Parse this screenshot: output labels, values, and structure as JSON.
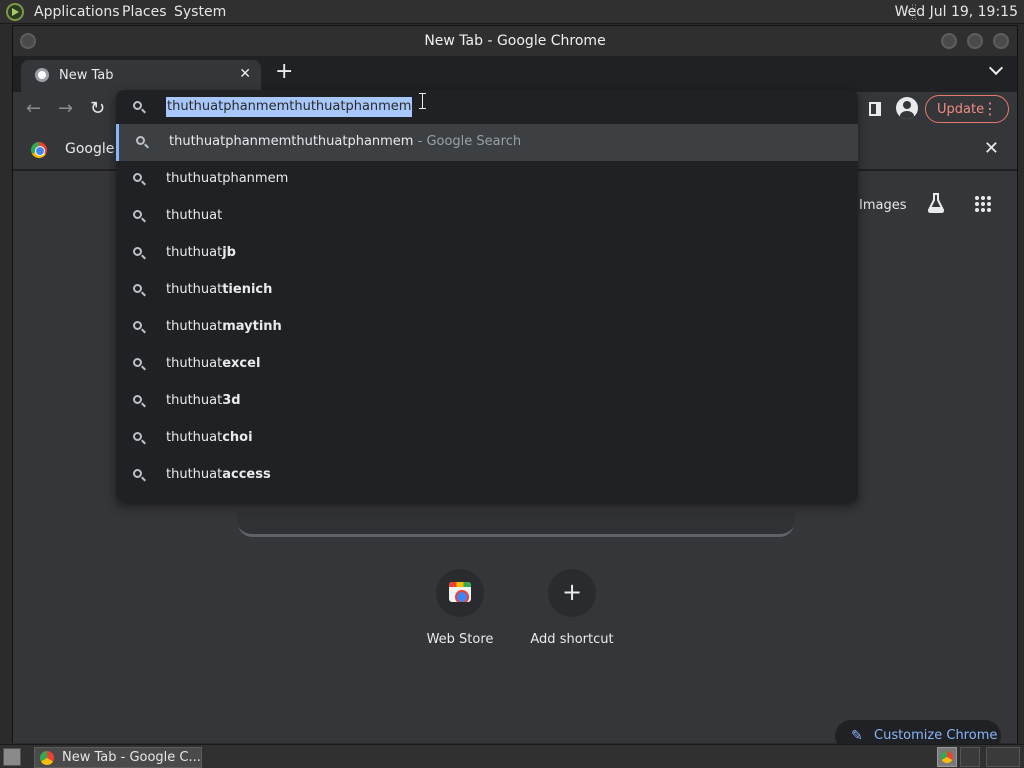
{
  "system_panel": {
    "menus": [
      "Applications",
      "Places",
      "System"
    ],
    "clock": "Wed Jul 19, 19:15"
  },
  "window": {
    "title": "New Tab - Google Chrome"
  },
  "tabs": [
    {
      "label": "New Tab"
    }
  ],
  "toolbar": {
    "update_label": "Update"
  },
  "bookmark_bar": {
    "label": "Google C"
  },
  "omnibox": {
    "value": "thuthuatphanmemthuthuatphanmem",
    "suggestions": [
      {
        "text": "thuthuatphanmemthuthuatphanmem",
        "bold": "",
        "hint": " - Google Search",
        "selected": true
      },
      {
        "text": "thuthuatphanmem",
        "bold": "",
        "hint": ""
      },
      {
        "text": "thuthuat",
        "bold": "",
        "hint": ""
      },
      {
        "text": "thuthuat",
        "bold": "jb",
        "hint": ""
      },
      {
        "text": "thuthuat",
        "bold": "tienich",
        "hint": ""
      },
      {
        "text": "thuthuat",
        "bold": "maytinh",
        "hint": ""
      },
      {
        "text": "thuthuat",
        "bold": "excel",
        "hint": ""
      },
      {
        "text": "thuthuat",
        "bold": "3d",
        "hint": ""
      },
      {
        "text": "thuthuat",
        "bold": "choi",
        "hint": ""
      },
      {
        "text": "thuthuat",
        "bold": "access",
        "hint": ""
      }
    ]
  },
  "page": {
    "images_link": "Images",
    "shortcuts": [
      {
        "label": "Web Store"
      },
      {
        "label": "Add shortcut"
      }
    ],
    "customize_label": "Customize Chrome"
  },
  "taskbar": {
    "task_label": "New Tab - Google C..."
  },
  "colors": {
    "accent": "#8ab4f8",
    "update": "#f28b82",
    "selection": "#a8c7fa"
  }
}
